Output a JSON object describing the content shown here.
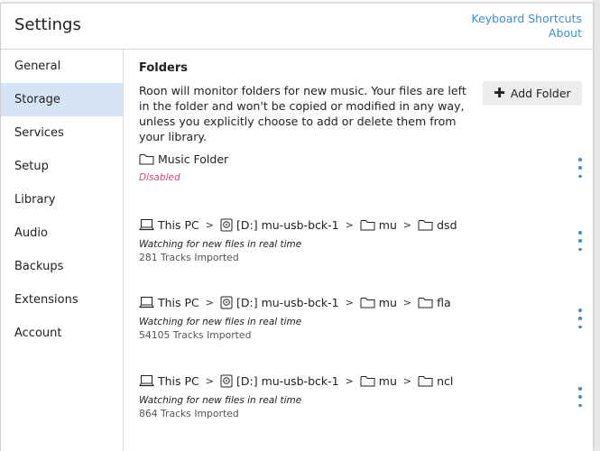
{
  "header": {
    "title": "Settings",
    "links": [
      "Keyboard Shortcuts",
      "About"
    ]
  },
  "sidebar": {
    "items": [
      {
        "label": "General"
      },
      {
        "label": "Storage",
        "active": true
      },
      {
        "label": "Services"
      },
      {
        "label": "Setup"
      },
      {
        "label": "Library"
      },
      {
        "label": "Audio"
      },
      {
        "label": "Backups"
      },
      {
        "label": "Extensions"
      },
      {
        "label": "Account"
      }
    ]
  },
  "main": {
    "section_title": "Folders",
    "description": "Roon will monitor folders for new music. Your files are left in the folder and won't be copied or modified in any way, unless you explicitly choose to add or delete them from your library.",
    "add_folder_label": "Add Folder",
    "folders": [
      {
        "name": "Music Folder",
        "status": "Disabled"
      },
      {
        "computer": "This PC",
        "drive": "[D:] mu-usb-bck-1",
        "dir1": "mu",
        "dir2": "dsd",
        "status": "Watching for new files in real time",
        "tracks": "281 Tracks Imported"
      },
      {
        "computer": "This PC",
        "drive": "[D:] mu-usb-bck-1",
        "dir1": "mu",
        "dir2": "fla",
        "status": "Watching for new files in real time",
        "tracks": "54105 Tracks Imported"
      },
      {
        "computer": "This PC",
        "drive": "[D:] mu-usb-bck-1",
        "dir1": "mu",
        "dir2": "ncl",
        "status": "Watching for new files in real time",
        "tracks": "864 Tracks Imported"
      }
    ]
  },
  "colors": {
    "accent": "#3d8fd1",
    "active_bg": "#d5e5f5",
    "disabled": "#d94a78"
  },
  "icons": [
    "folder-icon",
    "computer-icon",
    "drive-icon",
    "chevron-right-icon",
    "kebab-menu-icon",
    "plus-icon"
  ]
}
